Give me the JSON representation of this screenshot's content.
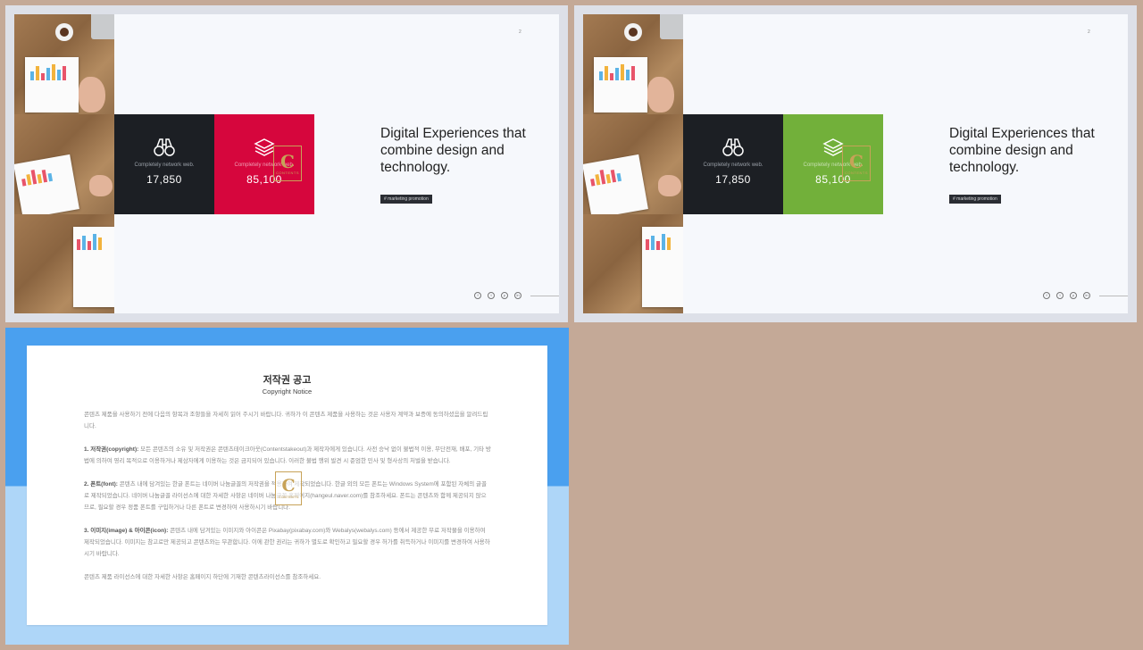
{
  "slides": [
    {
      "accent_color": "#d6063d",
      "stats": [
        {
          "label": "Completely network web.",
          "value": "17,850"
        },
        {
          "label": "Completely network web.",
          "value": "85,100"
        }
      ],
      "headline": "Digital Experiences that combine design and technology.",
      "tag": "# marketing promotion",
      "page_number": "2"
    },
    {
      "accent_color": "#72b03a",
      "stats": [
        {
          "label": "Completely network web.",
          "value": "17,850"
        },
        {
          "label": "Completely network web.",
          "value": "85,100"
        }
      ],
      "headline": "Digital Experiences that combine design and technology.",
      "tag": "# marketing promotion",
      "page_number": "2"
    }
  ],
  "icons": [
    "binoculars-icon",
    "layers-icon",
    "facebook-icon",
    "twitter-icon",
    "pinterest-icon",
    "linkedin-icon"
  ],
  "notice": {
    "title": "저작권 공고",
    "subtitle": "Copyright Notice",
    "intro": "콘텐츠 제품을 사용하기 전에 다음의 항목과 조항들을 자세히 읽어 주시기 바랍니다. 귀하가 이 콘텐츠 제품을 사용하는 것은 사용자 계약과 보증에 동의하셨음을 알려드립니다.",
    "sections": [
      {
        "heading": "1. 저작권(copyright):",
        "text": " 모든 콘텐츠의 소유 및 저작권은 콘텐츠테이크아웃(Contentstakeout)과 제작자에게 있습니다. 사전 승낙 없이 불법적 이용, 무단전재, 배포, 기타 방법에 의하여 영리 목적으로 이용하거나 제삼자에게 이용하는 것은 금지되어 있습니다. 이러한 불법 행위 발견 시 준엄한 민사 및 형사상의 처벌을 받습니다."
      },
      {
        "heading": "2. 폰트(font):",
        "text": " 콘텐츠 내에 담겨있는 한글 폰트는 네이버 나눔글꼴의 저작권을 적용하여 제작되었습니다. 한글 외의 모든 폰트는 Windows System에 포함된 자체의 글꼴로 제작되었습니다. 네이버 나눔글꼴 라이선스에 대한 자세한 사항은 네이버 나눔글꼴 홈페이지(hangeul.naver.com)를 참조하세요. 폰트는 콘텐츠와 함께 제공되지 않으므로, 필요할 경우 정품 폰트를 구입하거나 다른 폰트로 변경하여 사용하시기 바랍니다."
      },
      {
        "heading": "3. 이미지(image) & 아이콘(icon):",
        "text": " 콘텐츠 내에 담겨있는 이미지와 아이콘은 Pixabay(pixabay.com)와 Webalys(webalys.com) 등에서 제공한 무료 저작물을 이용하여 제작되었습니다. 이미지는 참고로만 제공되고 콘텐츠와는 무관합니다. 이에 관한 권리는 귀하가 별도로 확인하고 필요할 경우 허가를 취득하거나 이미지를 변경하여 사용하시기 바랍니다."
      }
    ],
    "closing": "콘텐츠 제품 라이선스에 대한 자세한 사항은 홈페이지 하단에 기재한 콘텐츠라이선스를 참조하세요."
  }
}
